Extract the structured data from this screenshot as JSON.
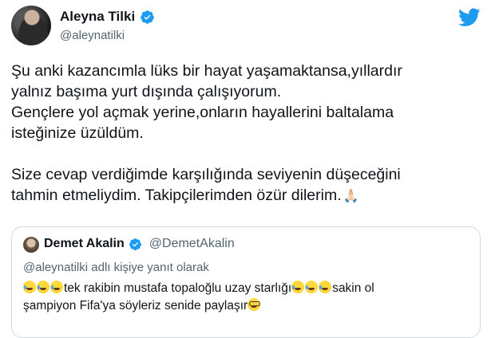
{
  "author": {
    "name": "Aleyna Tilki",
    "handle": "@aleynatilki",
    "avatar_icon": "profile-photo"
  },
  "tweet": {
    "text": "Şu anki kazancımla lüks bir hayat yaşamaktansa,yıllardır\nyalnız başıma yurt dışında çalışıyorum.\nGençlere yol açmak yerine,onların hayallerini baltalama\nisteğinize üzüldüm.\n\nSize cevap verdiğimde karşılığında seviyenin düşeceğini\ntahmin etmeliydim. Takipçilerimden özür dilerim.",
    "trailing_emoji": "🙏🏻"
  },
  "quote": {
    "name": "Demet Akalin",
    "handle": "@DemetAkalin",
    "reply_to": "@aleynatilki adlı kişiye yanıt olarak",
    "text_part1": "tek rakibin mustafa topaloğlu uzay starlığı",
    "text_part2": "sakin ol",
    "text_part3": "şampiyon Fifa'ya söyleriz senide paylaşır"
  },
  "colors": {
    "verified_blue": "#1d9bf0",
    "twitter_blue": "#1d9bf0",
    "secondary_text": "#536471",
    "border": "#cfd9de"
  }
}
